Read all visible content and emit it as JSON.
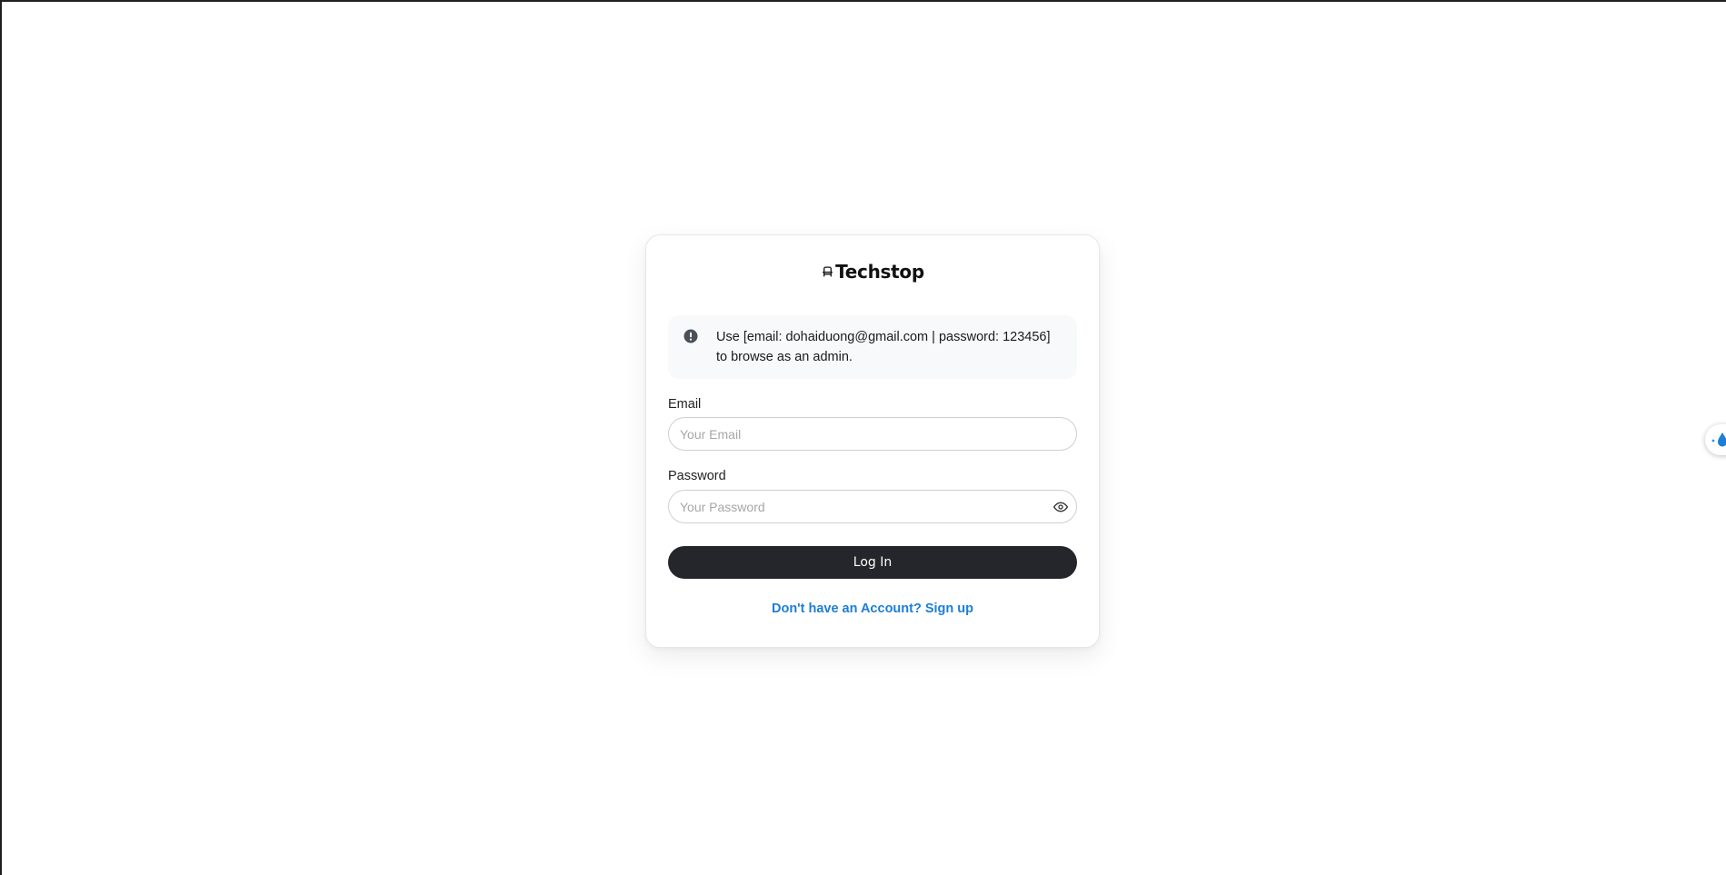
{
  "brand": {
    "name": "Techstop",
    "icon": "armchair-icon"
  },
  "alert": {
    "icon": "alert-circle-icon",
    "message": "Use [email: dohaiduong@gmail.com | password: 123456] to browse as an admin."
  },
  "form": {
    "email": {
      "label": "Email",
      "placeholder": "Your Email",
      "value": ""
    },
    "password": {
      "label": "Password",
      "placeholder": "Your Password",
      "value": "",
      "toggle_icon": "eye-icon"
    },
    "submit_label": "Log In",
    "signup_link": "Don't have an Account? Sign up"
  },
  "extension_widget": {
    "icon": "water-drop-icon"
  },
  "colors": {
    "button_bg": "#25262b",
    "link": "#1c7ed6",
    "alert_bg": "#f8f9fa",
    "alert_icon": "#495057"
  }
}
